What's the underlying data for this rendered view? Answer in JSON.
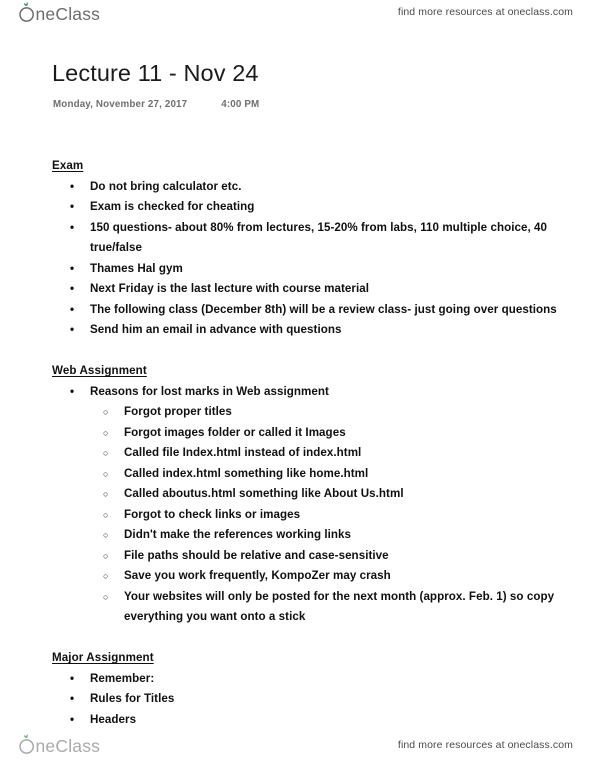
{
  "brand": {
    "name": "OneClass",
    "leaf_color": "#2f8a55",
    "wordmark_color": "#6d6d6d"
  },
  "header": {
    "tagline": "find more resources at oneclass.com"
  },
  "footer": {
    "tagline": "find more resources at oneclass.com"
  },
  "document": {
    "title": "Lecture 11 - Nov 24",
    "date": "Monday, November 27, 2017",
    "time": "4:00 PM",
    "sections": [
      {
        "heading": "Exam",
        "items": [
          {
            "level": 1,
            "text": "Do not bring calculator etc."
          },
          {
            "level": 1,
            "text": "Exam is checked for cheating"
          },
          {
            "level": 1,
            "text": "150 questions- about 80% from lectures, 15-20% from labs, 110 multiple choice, 40 true/false"
          },
          {
            "level": 1,
            "text": "Thames Hal gym"
          },
          {
            "level": 1,
            "text": "Next Friday is the last lecture with course material"
          },
          {
            "level": 1,
            "text": "The following class (December 8th) will be a review class- just going over questions"
          },
          {
            "level": 1,
            "text": "Send him an email in advance with questions"
          }
        ]
      },
      {
        "heading": "Web Assignment",
        "items": [
          {
            "level": 1,
            "text": "Reasons for lost marks in Web assignment"
          },
          {
            "level": 2,
            "text": "Forgot proper titles"
          },
          {
            "level": 2,
            "text": "Forgot images folder or called it Images"
          },
          {
            "level": 2,
            "text": "Called file Index.html instead of index.html"
          },
          {
            "level": 2,
            "text": "Called index.html something like home.html"
          },
          {
            "level": 2,
            "text": "Called aboutus.html something like About Us.html"
          },
          {
            "level": 2,
            "text": "Forgot to check links or images"
          },
          {
            "level": 2,
            "text": "Didn't make the references working links"
          },
          {
            "level": 2,
            "text": "File paths should be relative and case-sensitive"
          },
          {
            "level": 2,
            "text": "Save you work frequently, KompoZer may crash"
          },
          {
            "level": 2,
            "text": "Your websites will only be posted for the next month (approx. Feb. 1) so copy everything you want onto a stick"
          }
        ]
      },
      {
        "heading": "Major Assignment",
        "items": [
          {
            "level": 1,
            "text": "Remember:"
          },
          {
            "level": 1,
            "text": "Rules for Titles"
          },
          {
            "level": 1,
            "text": "Headers"
          }
        ]
      }
    ]
  },
  "bullets": {
    "level1_glyph": "•",
    "level2_glyph": "○"
  }
}
